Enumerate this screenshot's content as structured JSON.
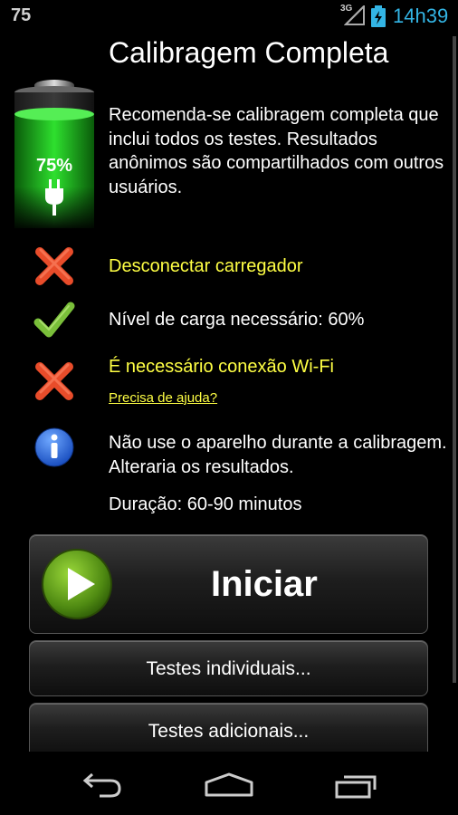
{
  "status_bar": {
    "left_number": "75",
    "network": "3G",
    "time": "14h39"
  },
  "battery": {
    "percent_label": "75%",
    "level": 0.75
  },
  "title": "Calibragem Completa",
  "description": "Recomenda-se calibragem completa que inclui todos os testes. Resultados anônimos são compartilhados com outros usuários.",
  "requirements": [
    {
      "icon": "cross-icon",
      "text": "Desconectar carregador",
      "status": "fail"
    },
    {
      "icon": "check-icon",
      "text": "Nível de carga necessário: 60%",
      "status": "ok"
    },
    {
      "icon": "cross-icon",
      "text": "É necessário conexão Wi-Fi",
      "status": "fail"
    }
  ],
  "help_link": "Precisa de ajuda?",
  "info": "Não use o aparelho durante a calibragem. Alteraria os resultados.",
  "duration": "Duração: 60-90 minutos",
  "buttons": {
    "start": "Iniciar",
    "individual": "Testes individuais...",
    "additional": "Testes adicionais..."
  },
  "colors": {
    "accent_blue": "#33b5e5",
    "warning_yellow": "#ffff44",
    "battery_green": "#22cc22"
  }
}
